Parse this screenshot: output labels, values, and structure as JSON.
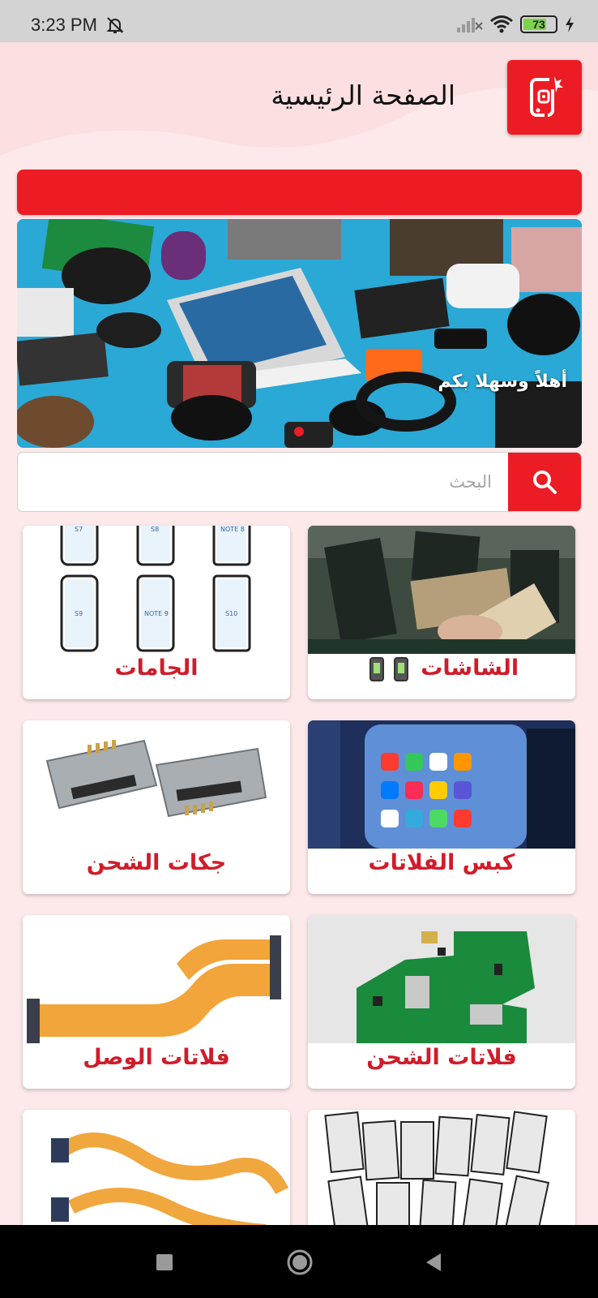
{
  "status_bar": {
    "time": "3:23 PM",
    "battery": "73",
    "battery_level": 0.73,
    "icons": [
      "bell-muted-icon",
      "signal-icon",
      "wifi-icon",
      "battery-icon",
      "charging-bolt-icon"
    ]
  },
  "header": {
    "title": "الصفحة الرئيسية",
    "logo_icon": "phone-repair-logo-icon"
  },
  "banner": {
    "caption": "أهلاً وسهلا بكم"
  },
  "search": {
    "placeholder": "البحث",
    "value": ""
  },
  "categories": [
    {
      "label": "الشاشات"
    },
    {
      "label": "الجامات"
    },
    {
      "label": "كبس الفلاتات"
    },
    {
      "label": "جكات الشحن"
    },
    {
      "label": "فلاتات الشحن"
    },
    {
      "label": "فلاتات الوصل"
    },
    {
      "label": ""
    },
    {
      "label": ""
    }
  ],
  "glass_models": [
    "S7",
    "S8",
    "NOTE 8",
    "S9",
    "NOTE 9",
    "S10"
  ],
  "colors": {
    "accent": "#ec1c24",
    "label": "#d01c2a",
    "background": "#fde9ea"
  }
}
